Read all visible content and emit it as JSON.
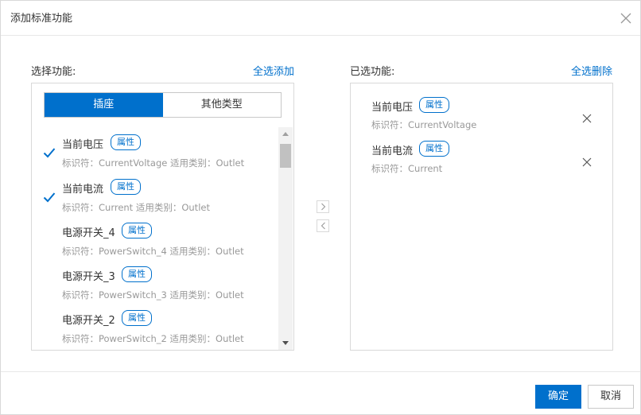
{
  "dialog": {
    "title": "添加标准功能",
    "close_icon": "close-icon"
  },
  "left": {
    "label": "选择功能:",
    "select_all_link": "全选添加",
    "tabs": [
      {
        "label": "插座",
        "active": true
      },
      {
        "label": "其他类型",
        "active": false
      }
    ],
    "items": [
      {
        "name": "当前电压",
        "badge": "属性",
        "meta": "标识符：CurrentVoltage  适用类别：Outlet",
        "checked": true
      },
      {
        "name": "当前电流",
        "badge": "属性",
        "meta": "标识符：Current  适用类别：Outlet",
        "checked": true
      },
      {
        "name": "电源开关_4",
        "badge": "属性",
        "meta": "标识符：PowerSwitch_4  适用类别：Outlet",
        "checked": false
      },
      {
        "name": "电源开关_3",
        "badge": "属性",
        "meta": "标识符：PowerSwitch_3  适用类别：Outlet",
        "checked": false
      },
      {
        "name": "电源开关_2",
        "badge": "属性",
        "meta": "标识符：PowerSwitch_2  适用类别：Outlet",
        "checked": false
      }
    ]
  },
  "right": {
    "label": "已选功能:",
    "delete_all_link": "全选删除",
    "items": [
      {
        "name": "当前电压",
        "badge": "属性",
        "meta": "标识符：CurrentVoltage"
      },
      {
        "name": "当前电流",
        "badge": "属性",
        "meta": "标识符：Current"
      }
    ]
  },
  "footer": {
    "ok_label": "确定",
    "cancel_label": "取消"
  },
  "colors": {
    "accent": "#0070cc",
    "muted_text": "#999999",
    "border": "#d9d9d9"
  }
}
